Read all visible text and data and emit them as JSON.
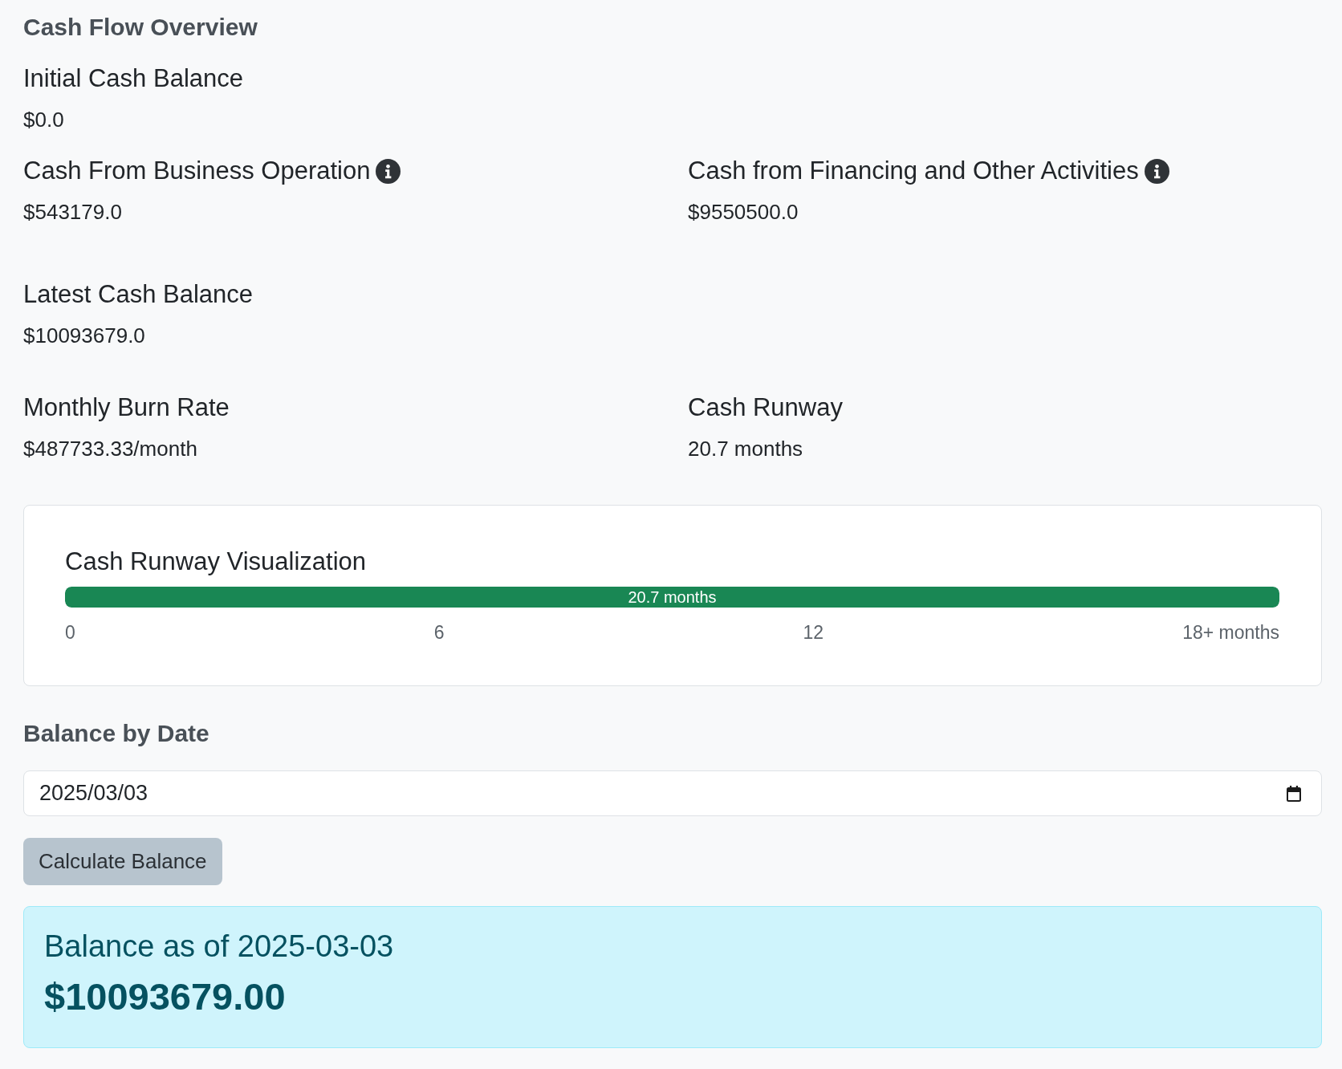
{
  "overview": {
    "title": "Cash Flow Overview",
    "rows": [
      {
        "metrics": [
          {
            "label": "Initial Cash Balance",
            "value": "$0.0",
            "info": false
          }
        ]
      },
      {
        "metrics": [
          {
            "label": "Cash From Business Operation",
            "value": "$543179.0",
            "info": true
          },
          {
            "label": "Cash from Financing and Other Activities",
            "value": "$9550500.0",
            "info": true
          }
        ]
      },
      {
        "metrics": [
          {
            "label": "Latest Cash Balance",
            "value": "$10093679.0",
            "info": false
          }
        ]
      },
      {
        "metrics": [
          {
            "label": "Monthly Burn Rate",
            "value": "$487733.33/month",
            "info": false
          },
          {
            "label": "Cash Runway",
            "value": "20.7 months",
            "info": false
          }
        ]
      }
    ]
  },
  "runway_card": {
    "title": "Cash Runway Visualization",
    "progress": {
      "level": 1,
      "label": "20.7 months"
    },
    "ticks": [
      "0",
      "6",
      "12",
      "18+ months"
    ]
  },
  "balance_by_date": {
    "title": "Balance by Date",
    "date_field": {
      "value": "2025/03/03"
    },
    "button": "Calculate Balance",
    "result": {
      "heading": "Balance as of 2025-03-03",
      "amount": "$10093679.00"
    }
  }
}
